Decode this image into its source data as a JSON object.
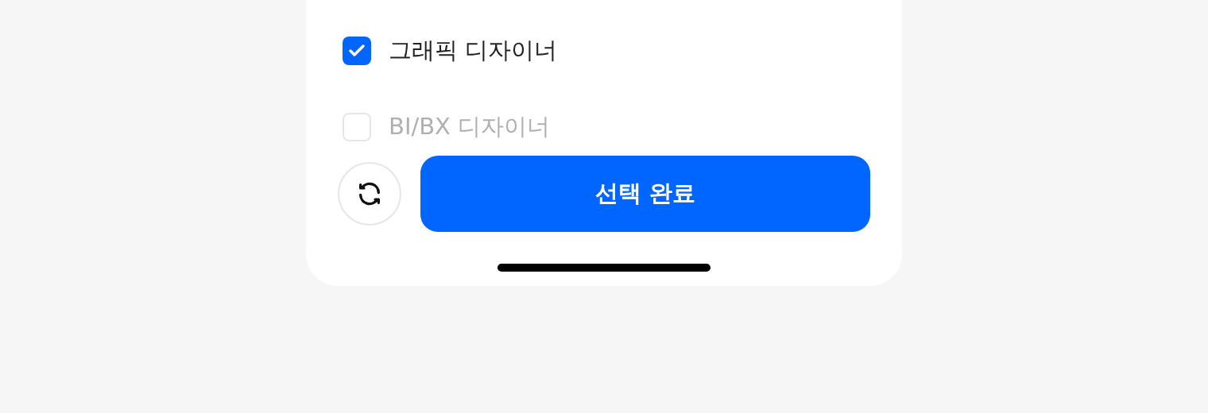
{
  "options": [
    {
      "label": "그래픽 디자이너",
      "checked": true
    },
    {
      "label": "BI/BX 디자이너",
      "checked": false
    }
  ],
  "confirm_button": "선택 완료"
}
